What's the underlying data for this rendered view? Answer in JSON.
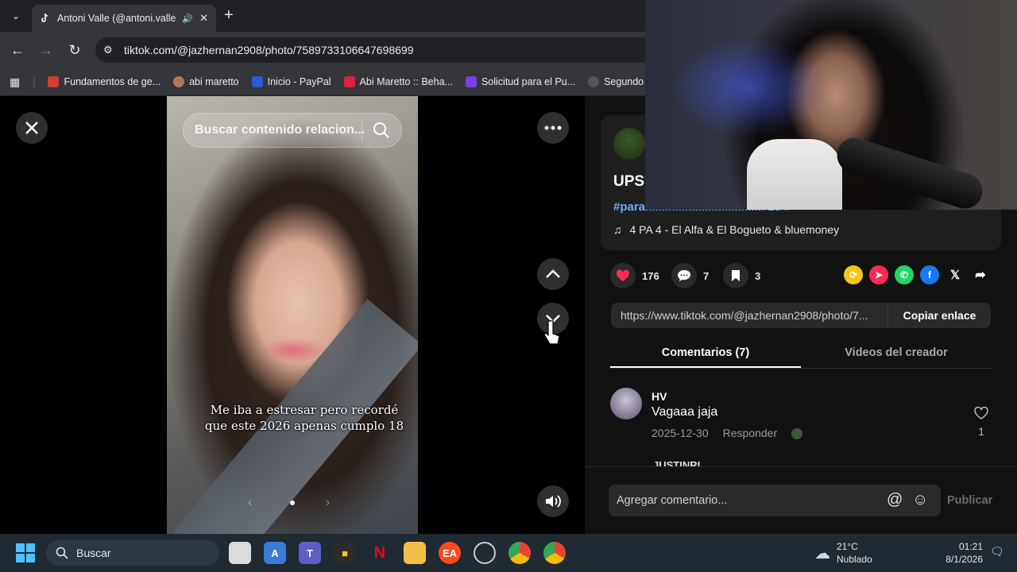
{
  "browser": {
    "tab_title": "Antoni Valle (@antoni.valle(",
    "url": "tiktok.com/@jazhernan2908/photo/7589733106647698699",
    "bookmarks": [
      {
        "label": "Fundamentos de ge...",
        "color": "#d43c2f"
      },
      {
        "label": "abi maretto",
        "color": "#b07858"
      },
      {
        "label": "Inicio - PayPal",
        "color": "#2a5bd7"
      },
      {
        "label": "Abi Maretto :: Beha...",
        "color": "#e02040"
      },
      {
        "label": "Solicitud para el Pu...",
        "color": "#7b3fe4"
      },
      {
        "label": "Segundo",
        "color": "#555555"
      }
    ]
  },
  "viewer": {
    "search_placeholder": "Buscar contenido relacion...",
    "caption": "Me iba a estresar pero recordé que este 2026 apenas cumplo 18"
  },
  "post": {
    "title": "UPS",
    "hashtag": "#para...................................#15 #",
    "music": "4 PA 4 - El Alfa & El Bogueto & bluemoney",
    "likes": "176",
    "comments": "7",
    "saves": "3",
    "link": "https://www.tiktok.com/@jazhernan2908/photo/7...",
    "copy_label": "Copiar enlace"
  },
  "tabs": {
    "comments": "Comentarios (7)",
    "videos": "Videos del creador"
  },
  "comment": {
    "user": "HV",
    "text": "Vagaaa jaja",
    "date": "2025-12-30",
    "reply": "Responder",
    "likes": "1",
    "next_user": "JUSTINRI"
  },
  "composer": {
    "placeholder": "Agregar comentario...",
    "publish": "Publicar"
  },
  "taskbar": {
    "search": "Buscar",
    "temp": "21°C",
    "weather": "Nublado",
    "time": "01:21",
    "date": "8/1/2026"
  }
}
